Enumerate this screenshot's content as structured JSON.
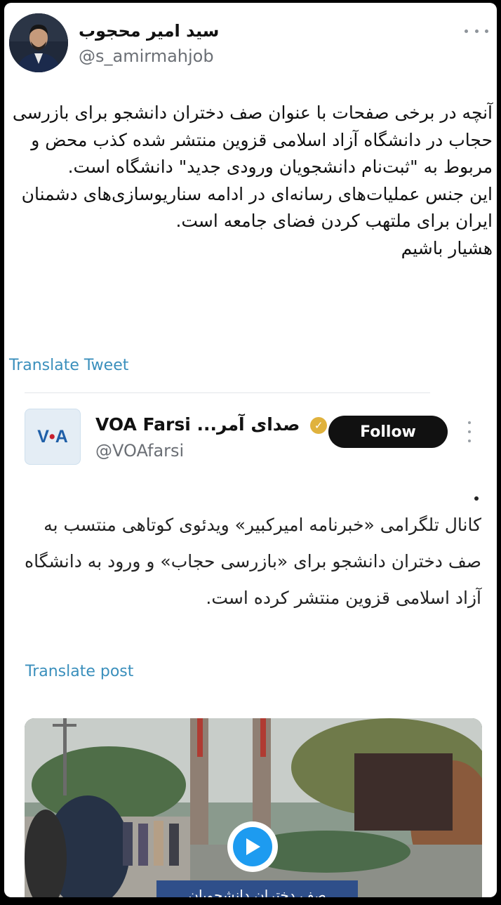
{
  "tweet": {
    "author_name": "سید امیر محجوب",
    "author_handle": "@s_amirmahjob",
    "body": [
      "آنچه در برخی صفحات با عنوان صف دختران دانشجو برای بازرسی حجاب در دانشگاه آزاد اسلامی قزوین منتشر شده کذب محض و مربوط به \"ثبت‌نام دانشجویان ورودی جدید\" دانشگاه است.",
      "این جنس عملیات‌های رسانه‌ای در ادامه سناریوسازی‌های دشمنان ایران برای ملتهب کردن فضای جامعه است.",
      "هشیار باشیم"
    ],
    "translate_label": "Translate Tweet",
    "more_icon": "more-horizontal-icon"
  },
  "quote": {
    "logo_text_a": "V",
    "logo_text_b": "•",
    "logo_text_c": "A",
    "name_en": "VOA Farsi",
    "name_fa": "صدای آمر...",
    "verified_icon": "verified-badge-icon",
    "handle": "@VOAfarsi",
    "follow_label": "Follow",
    "body": "کانال تلگرامی «خبرنامه امیرکبیر» ویدئوی کوتاهی منتسب به صف دختران دانشجو برای «بازرسی حجاب» و ورود به دانشگاه آزاد اسلامی قزوین منتشر کرده است.",
    "translate_label": "Translate post",
    "video_caption": "صف دختران دانشجویان"
  },
  "colors": {
    "link": "#3a8fbc",
    "verified": "#e0b23d",
    "play": "#1d9bf0"
  }
}
